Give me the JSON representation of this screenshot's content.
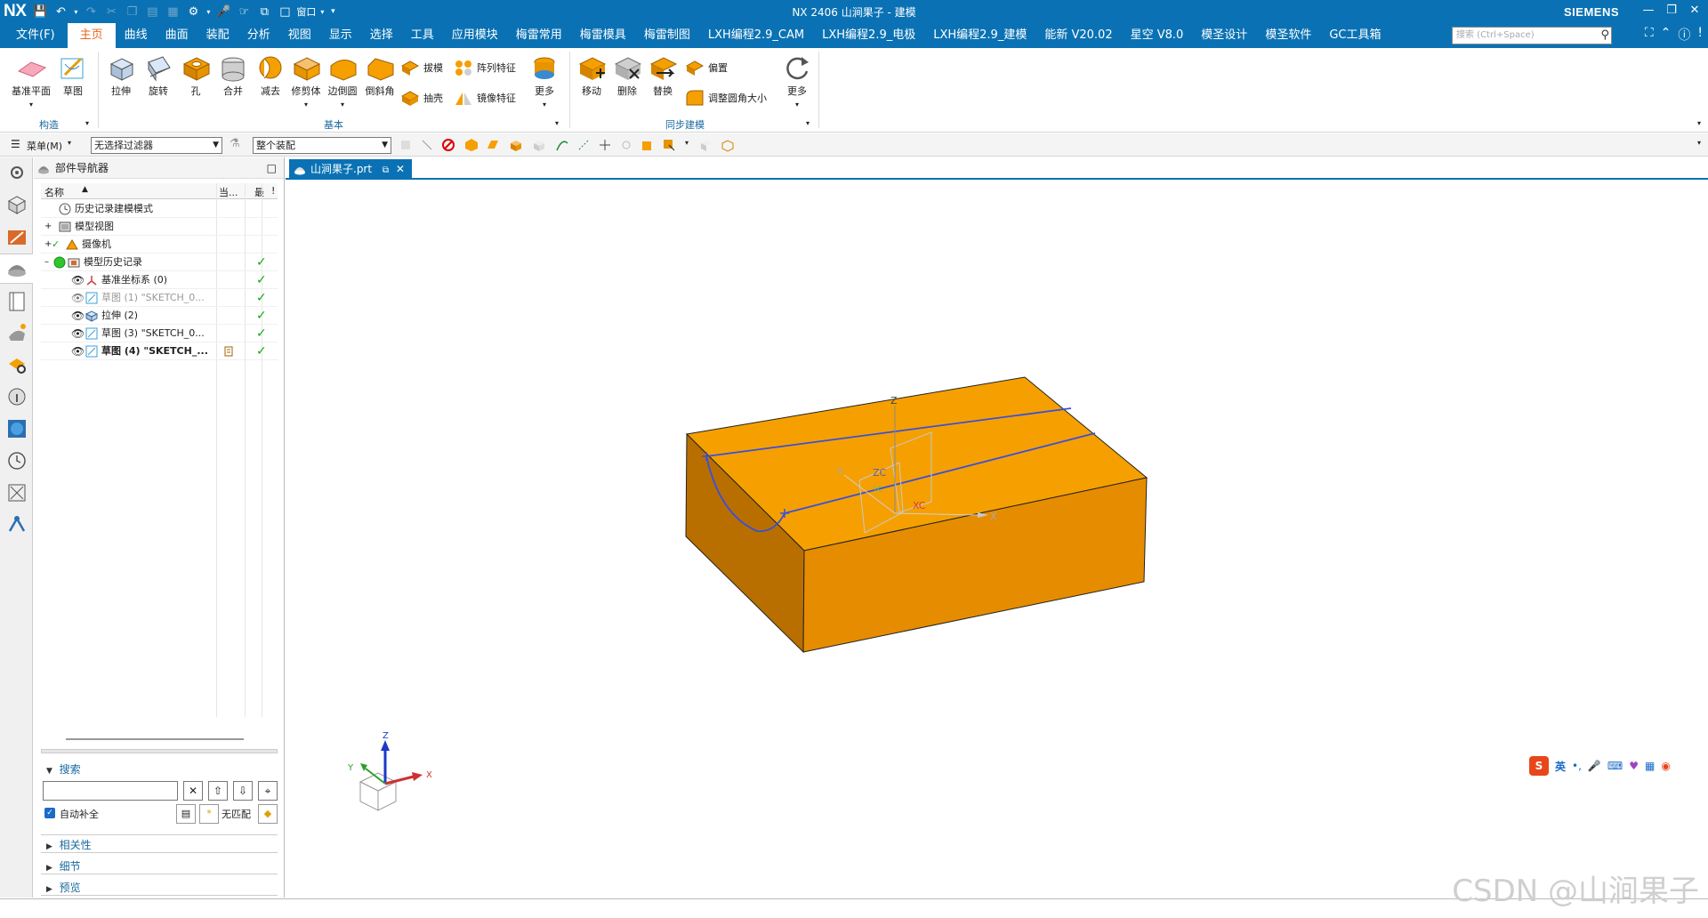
{
  "app": {
    "logo": "NX",
    "title": "NX 2406 山涧果子 - 建模",
    "brand": "SIEMENS",
    "window_label": "窗口"
  },
  "menu": {
    "items": [
      "文件(F)",
      "主页",
      "曲线",
      "曲面",
      "装配",
      "分析",
      "视图",
      "显示",
      "选择",
      "工具",
      "应用模块",
      "梅雷常用",
      "梅雷模具",
      "梅雷制图",
      "LXH编程2.9_CAM",
      "LXH编程2.9_电极",
      "LXH编程2.9_建模",
      "能新 V20.02",
      "星空 V8.0",
      "模圣设计",
      "模圣软件",
      "GC工具箱"
    ],
    "active": "主页",
    "search_placeholder": "搜索 (Ctrl+Space)"
  },
  "ribbon": {
    "construct": {
      "datum": "基准平面",
      "sketch": "草图",
      "group": "构造"
    },
    "basic": {
      "extrude": "拉伸",
      "revolve": "旋转",
      "hole": "孔",
      "unite": "合并",
      "subtract": "减去",
      "trim": "修剪体",
      "edge_blend": "边倒圆",
      "chamfer": "倒斜角",
      "draft": "拔模",
      "pattern": "阵列特征",
      "shell": "抽壳",
      "mirror": "镜像特征",
      "more": "更多",
      "group": "基本"
    },
    "sync": {
      "move": "移动",
      "delete": "删除",
      "replace": "替换",
      "offset": "偏置",
      "resize_blend": "调整圆角大小",
      "more": "更多",
      "group": "同步建模"
    }
  },
  "toolbar2": {
    "menu": "菜单(M)",
    "filter": "无选择过滤器",
    "scope": "整个装配"
  },
  "navigator": {
    "title": "部件导航器",
    "col_name": "名称",
    "col_current": "当...",
    "col_latest": "最",
    "rows": [
      {
        "text": "历史记录建模模式",
        "state": "normal"
      },
      {
        "text": "模型视图",
        "state": "normal"
      },
      {
        "text": "摄像机",
        "state": "normal"
      },
      {
        "text": "模型历史记录",
        "state": "normal"
      },
      {
        "text": "基准坐标系 (0)",
        "state": "normal"
      },
      {
        "text": "草图 (1) \"SKETCH_0...",
        "state": "gray"
      },
      {
        "text": "拉伸 (2)",
        "state": "normal"
      },
      {
        "text": "草图 (3) \"SKETCH_0...",
        "state": "normal"
      },
      {
        "text": "草图 (4) \"SKETCH_...",
        "state": "bold"
      }
    ],
    "check": "✓"
  },
  "search_panel": {
    "title": "搜索",
    "autocomplete": "自动补全",
    "nomatch": "无匹配",
    "sections": [
      "相关性",
      "细节",
      "预览"
    ]
  },
  "tab": {
    "label": "山涧果子.prt"
  },
  "viewport": {
    "axis_labels": {
      "z": "Z",
      "x": "X",
      "y": "Y",
      "zc": "ZC",
      "xc": "XC",
      "yc": "YC"
    },
    "body_color": "#f5a000",
    "sketch_color": "#3a50d9"
  },
  "ime": {
    "mode": "英"
  },
  "watermark": "CSDN @山涧果子"
}
